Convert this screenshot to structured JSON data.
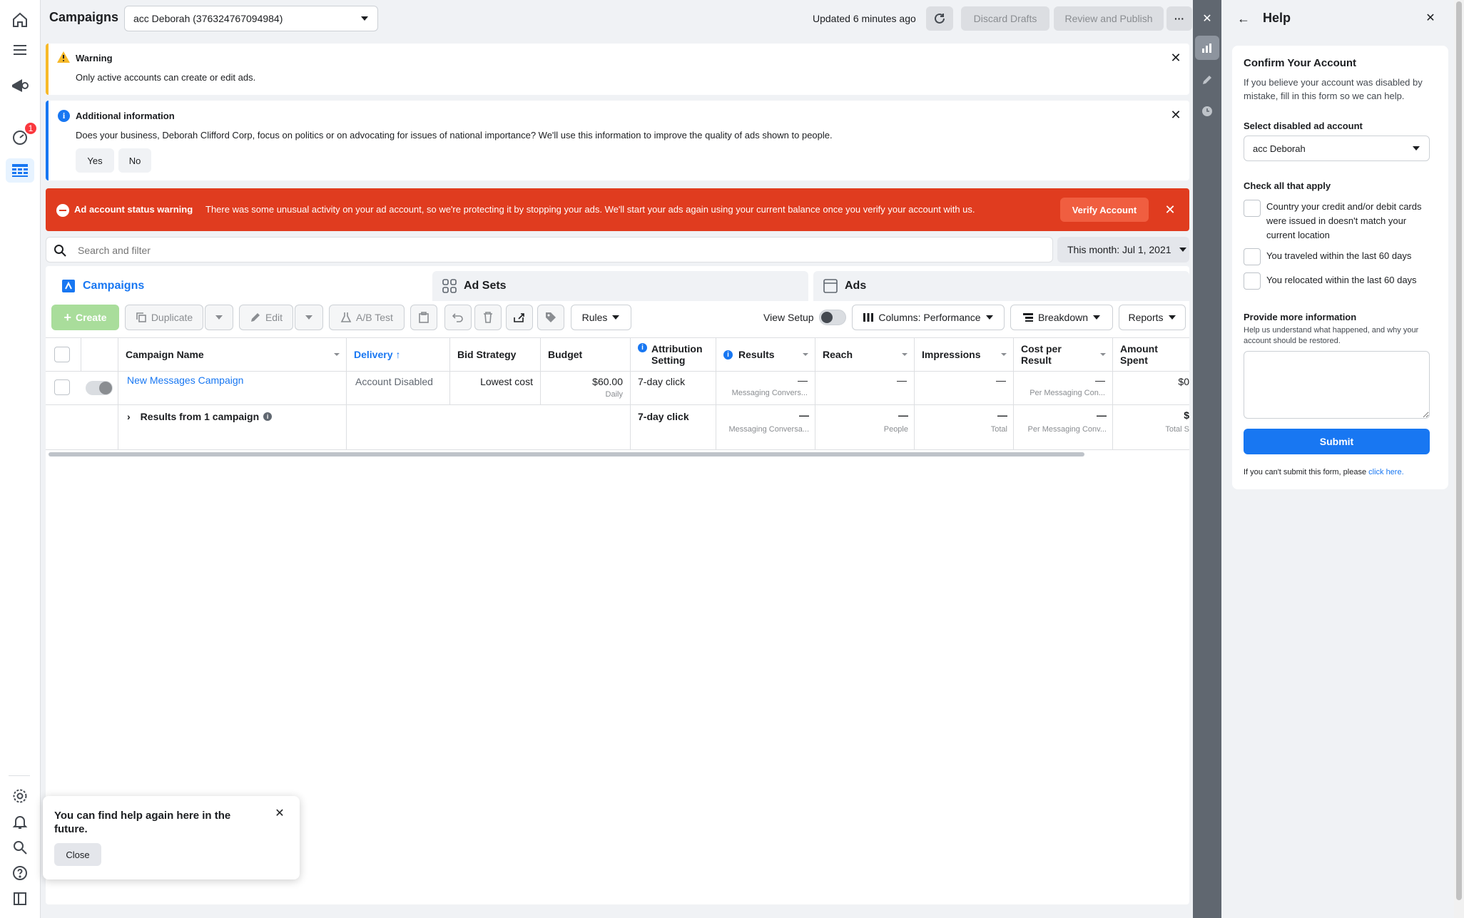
{
  "topbar": {
    "title": "Campaigns",
    "account_select": "acc Deborah (376324767094984)",
    "updated": "Updated 6 minutes ago",
    "discard": "Discard Drafts",
    "review": "Review and Publish",
    "more": "···"
  },
  "nav": {
    "notification_count": "1"
  },
  "warning": {
    "title": "Warning",
    "text": "Only active accounts can create or edit ads."
  },
  "info": {
    "title": "Additional information",
    "text": "Does your business, Deborah Clifford Corp, focus on politics or on advocating for issues of national importance? We'll use this information to improve the quality of ads shown to people.",
    "yes": "Yes",
    "no": "No"
  },
  "error": {
    "title": "Ad account status warning",
    "text": "There was some unusual activity on your ad account, so we're protecting it by stopping your ads. We'll start your ads again using your current balance once you verify your account with us.",
    "verify": "Verify Account"
  },
  "search": {
    "placeholder": "Search and filter",
    "date": "This month: Jul 1, 2021"
  },
  "tabs": {
    "campaigns": "Campaigns",
    "adsets": "Ad Sets",
    "ads": "Ads"
  },
  "toolbar": {
    "create": "Create",
    "duplicate": "Duplicate",
    "edit": "Edit",
    "ab_test": "A/B Test",
    "rules": "Rules",
    "view_setup": "View Setup",
    "columns": "Columns: Performance",
    "breakdown": "Breakdown",
    "reports": "Reports"
  },
  "table": {
    "headers": {
      "name": "Campaign Name",
      "delivery": "Delivery",
      "bid": "Bid Strategy",
      "budget": "Budget",
      "attribution": "Attribution Setting",
      "results": "Results",
      "reach": "Reach",
      "impressions": "Impressions",
      "cpr": "Cost per Result",
      "amount": "Amount Spent"
    },
    "row": {
      "name": "New Messages Campaign",
      "delivery": "Account Disabled",
      "bid": "Lowest cost",
      "budget": "$60.00",
      "budget_sub": "Daily",
      "attribution": "7-day click",
      "results": "—",
      "results_sub": "Messaging Convers...",
      "reach": "—",
      "impressions": "—",
      "cpr": "—",
      "cpr_sub": "Per Messaging Con...",
      "amount": "$0"
    },
    "total": {
      "label": "Results from 1 campaign",
      "attribution": "7-day click",
      "results": "—",
      "results_sub": "Messaging Conversa...",
      "reach": "—",
      "reach_sub": "People",
      "impressions": "—",
      "impressions_sub": "Total",
      "cpr": "—",
      "cpr_sub": "Per Messaging Conv...",
      "amount": "$",
      "amount_sub": "Total S"
    }
  },
  "tooltip": {
    "text": "You can find help again here in the future.",
    "close": "Close"
  },
  "help": {
    "title": "Help",
    "card_title": "Confirm Your Account",
    "card_desc": "If you believe your account was disabled by mistake, fill in this form so we can help.",
    "select_label": "Select disabled ad account",
    "select_value": "acc Deborah",
    "check_label": "Check all that apply",
    "opt1": "Country your credit and/or debit cards were issued in doesn't match your current location",
    "opt2": "You traveled within the last 60 days",
    "opt3": "You relocated within the last 60 days",
    "more_label": "Provide more information",
    "more_desc": "Help us understand what happened, and why your account should be restored.",
    "submit": "Submit",
    "footer": "If you can't submit this form, please ",
    "footer_link": "click here."
  },
  "colors": {
    "primary": "#1877f2",
    "error": "#e03c1f",
    "warning": "#f7b928",
    "create": "#a9dd9b"
  }
}
